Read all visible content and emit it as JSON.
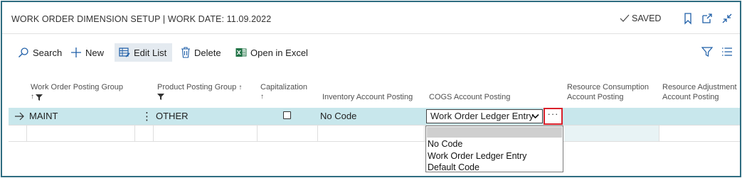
{
  "header": {
    "title": "WORK ORDER DIMENSION SETUP | WORK DATE: 11.09.2022",
    "saved_label": "SAVED",
    "icons": [
      "checkmark-icon",
      "bookmark-icon",
      "open-new-window-icon",
      "collapse-icon"
    ]
  },
  "actions": {
    "search": "Search",
    "new": "New",
    "edit_list": "Edit List",
    "delete": "Delete",
    "open_excel": "Open in Excel",
    "icons": [
      "filter-icon",
      "list-view-icon"
    ]
  },
  "columns": {
    "work_order_posting_group": "Work Order Posting Group",
    "product_posting_group": "Product Posting Group",
    "capitalization": "Capitalization",
    "inventory_account_posting": "Inventory Account Posting",
    "cogs_account_posting": "COGS Account Posting",
    "resource_consumption_l1": "Resource Consumption",
    "resource_consumption_l2": "Account Posting",
    "resource_adjustment_l1": "Resource Adjustment",
    "resource_adjustment_l2": "Account Posting",
    "sort_up": "↑"
  },
  "rows": [
    {
      "work_order_posting_group": "MAINT",
      "product_posting_group": "OTHER",
      "capitalization": false,
      "inventory_account_posting": "No Code",
      "cogs_account_posting": "Work Order Ledger Entry",
      "row_menu": "⋮",
      "lookup": "···"
    }
  ],
  "cogs_dropdown": {
    "options": [
      "",
      "No Code",
      "Work Order Ledger Entry",
      "Default Code"
    ]
  },
  "colors": {
    "frame_border": "#2e6c80",
    "selected_row": "#c8e7ec",
    "highlight_box": "#d9202a",
    "accent_blue": "#1f5fa8",
    "excel_green": "#217346"
  }
}
